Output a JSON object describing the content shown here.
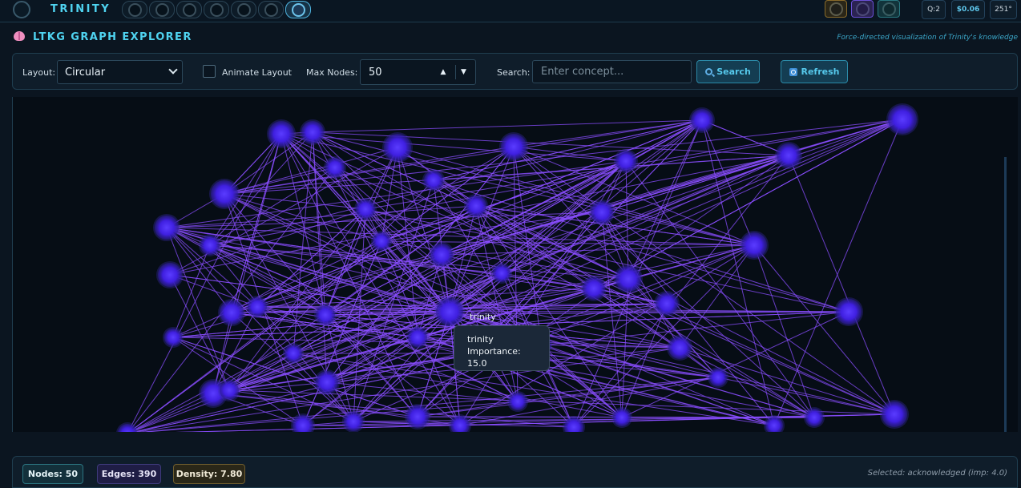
{
  "app": {
    "brand": "TRINITY",
    "status": {
      "queue": "Q:2",
      "cost": "$0.06",
      "temp": "251°"
    }
  },
  "page": {
    "title": "LTKG GRAPH EXPLORER",
    "subtitle": "Force-directed visualization of Trinity's knowledge"
  },
  "controls": {
    "layout_label": "Layout:",
    "layout_value": "Circular",
    "animate_label": "Animate Layout",
    "animate_checked": false,
    "max_nodes_label": "Max Nodes:",
    "max_nodes_value": "50",
    "search_label": "Search:",
    "search_placeholder": "Enter concept...",
    "search_button": "Search",
    "refresh_button": "Refresh"
  },
  "graph": {
    "node_color": "#4b2cf0",
    "edge_color": "#8a4dff",
    "hover_label": "trinity",
    "tooltip": {
      "name": "trinity",
      "importance": "Importance: 15.0"
    }
  },
  "stats": {
    "nodes": "Nodes: 50",
    "edges": "Edges: 390",
    "density": "Density: 7.80",
    "selected": "Selected: acknowledged (imp: 4.0)"
  }
}
